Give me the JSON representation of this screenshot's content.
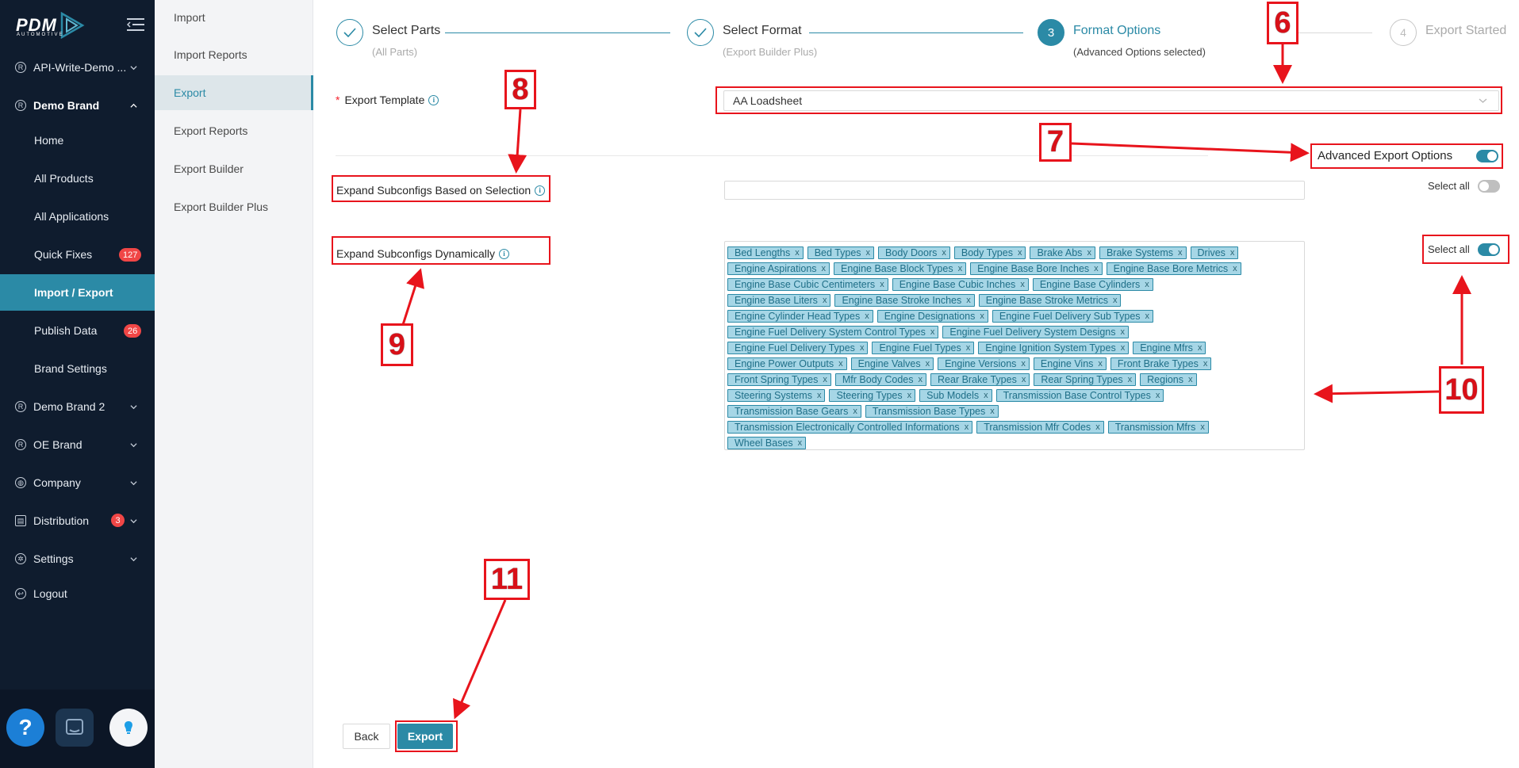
{
  "sidebar": {
    "logo_text": "PDM",
    "logo_subtext": "AUTOMOTIVE",
    "items": [
      {
        "label": "API-Write-Demo ...",
        "icon": "registered-icon"
      },
      {
        "label": "Demo Brand",
        "icon": "registered-icon"
      },
      {
        "label": "Demo Brand 2",
        "icon": "registered-icon"
      },
      {
        "label": "OE Brand",
        "icon": "registered-icon"
      },
      {
        "label": "Company",
        "icon": "globe-icon"
      },
      {
        "label": "Distribution",
        "icon": "distribution-icon",
        "badge": "3"
      },
      {
        "label": "Settings",
        "icon": "gear-icon"
      },
      {
        "label": "Logout",
        "icon": "logout-icon"
      }
    ],
    "demo_brand_sub": [
      {
        "label": "Home"
      },
      {
        "label": "All Products"
      },
      {
        "label": "All Applications"
      },
      {
        "label": "Quick Fixes",
        "badge": "127"
      },
      {
        "label": "Import / Export"
      },
      {
        "label": "Publish Data",
        "badge": "26"
      },
      {
        "label": "Brand Settings"
      }
    ]
  },
  "submenu": {
    "items": [
      {
        "label": "Import"
      },
      {
        "label": "Import Reports"
      },
      {
        "label": "Export"
      },
      {
        "label": "Export Reports"
      },
      {
        "label": "Export Builder"
      },
      {
        "label": "Export Builder Plus"
      }
    ]
  },
  "steps": [
    {
      "title": "Select Parts",
      "subtitle": "(All Parts)",
      "status": "done"
    },
    {
      "title": "Select Format",
      "subtitle": "(Export Builder Plus)",
      "status": "done"
    },
    {
      "number": "3",
      "title": "Format Options",
      "subtitle": "(Advanced Options selected)",
      "status": "current"
    },
    {
      "number": "4",
      "title": "Export Started",
      "subtitle": "",
      "status": "pending"
    }
  ],
  "form": {
    "export_template_label": "Export Template",
    "export_template_value": "AA Loadsheet",
    "advanced_label": "Advanced Export Options",
    "advanced_on": true,
    "expand_selection_label": "Expand Subconfigs Based on Selection",
    "expand_selection_select_all": "Select all",
    "expand_selection_on": false,
    "expand_dynamic_label": "Expand Subconfigs Dynamically",
    "expand_dynamic_select_all": "Select all",
    "expand_dynamic_on": true
  },
  "tag_rows": [
    [
      "Bed Lengths",
      "Bed Types",
      "Body Doors",
      "Body Types",
      "Brake Abs",
      "Brake Systems",
      "Drives"
    ],
    [
      "Engine Aspirations",
      "Engine Base Block Types",
      "Engine Base Bore Inches",
      "Engine Base Bore Metrics"
    ],
    [
      "Engine Base Cubic Centimeters",
      "Engine Base Cubic Inches",
      "Engine Base Cylinders"
    ],
    [
      "Engine Base Liters",
      "Engine Base Stroke Inches",
      "Engine Base Stroke Metrics"
    ],
    [
      "Engine Cylinder Head Types",
      "Engine Designations",
      "Engine Fuel Delivery Sub Types"
    ],
    [
      "Engine Fuel Delivery System Control Types",
      "Engine Fuel Delivery System Designs"
    ],
    [
      "Engine Fuel Delivery Types",
      "Engine Fuel Types",
      "Engine Ignition System Types",
      "Engine Mfrs"
    ],
    [
      "Engine Power Outputs",
      "Engine Valves",
      "Engine Versions",
      "Engine Vins",
      "Front Brake Types"
    ],
    [
      "Front Spring Types",
      "Mfr Body Codes",
      "Rear Brake Types",
      "Rear Spring Types",
      "Regions"
    ],
    [
      "Steering Systems",
      "Steering Types",
      "Sub Models",
      "Transmission Base Control Types"
    ],
    [
      "Transmission Base Gears",
      "Transmission Base Types"
    ],
    [
      "Transmission Electronically Controlled Informations",
      "Transmission Mfr Codes",
      "Transmission Mfrs"
    ],
    [
      "Wheel Bases"
    ]
  ],
  "tag_close_glyph": "x",
  "buttons": {
    "back": "Back",
    "export": "Export"
  },
  "annotations": [
    "6",
    "7",
    "8",
    "9",
    "10",
    "11"
  ],
  "colors": {
    "accent": "#2b8aa6",
    "sidebar_bg": "#0f1c2e",
    "annotation": "#e8141c",
    "badge": "#f04646"
  }
}
